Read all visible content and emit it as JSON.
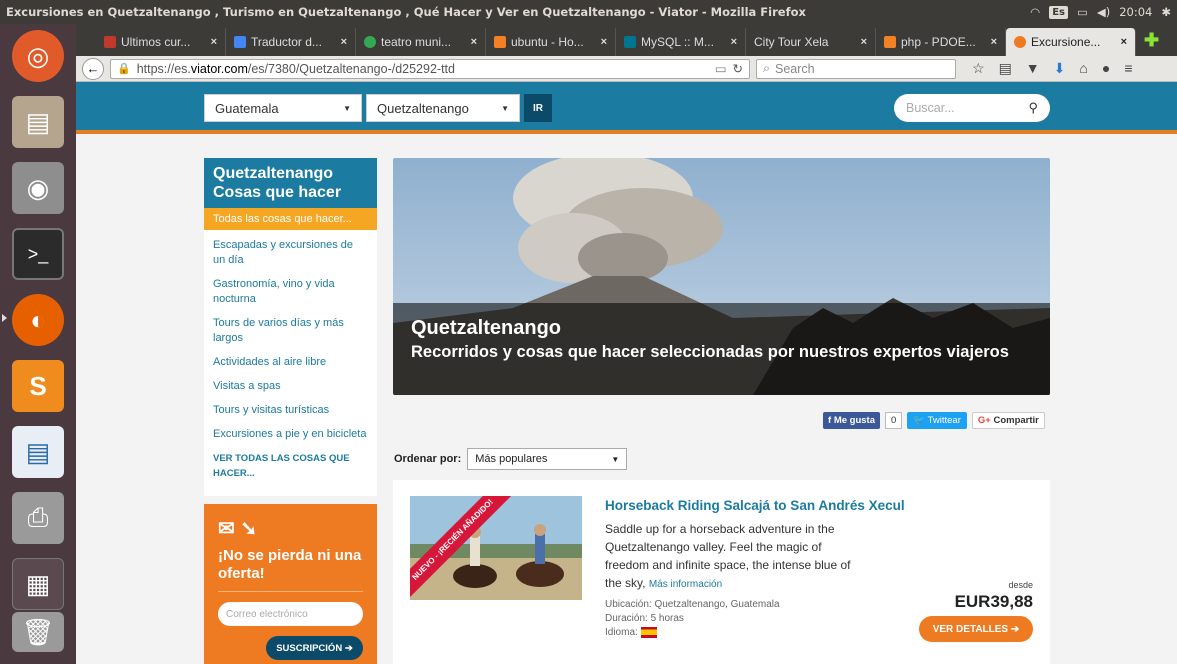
{
  "window_title": "Excursiones en Quetzaltenango , Turismo en Quetzaltenango , Qué Hacer y Ver en Quetzaltenango - Viator - Mozilla Firefox",
  "tray": {
    "lang": "Es",
    "time": "20:04"
  },
  "tabs": [
    {
      "label": "Ultimos cur...",
      "color": "#c0392b"
    },
    {
      "label": "Traductor d...",
      "color": "#4285f4"
    },
    {
      "label": "teatro muni...",
      "color": "#34a853"
    },
    {
      "label": "ubuntu - Ho...",
      "color": "#f48024"
    },
    {
      "label": "MySQL :: M...",
      "color": "#00758f"
    },
    {
      "label": "City Tour Xela",
      "color": ""
    },
    {
      "label": "php - PDOE...",
      "color": "#f48024"
    },
    {
      "label": "Excursione...",
      "color": "#ee7a22"
    }
  ],
  "url": {
    "prefix": "https://es.",
    "domain": "viator.com",
    "path": "/es/7380/Quetzaltenango-/d25292-ttd"
  },
  "browser_search_placeholder": "Search",
  "header": {
    "country": "Guatemala",
    "city": "Quetzaltenango",
    "go": "IR",
    "search_placeholder": "Buscar..."
  },
  "sidebar": {
    "title": "Quetzaltenango Cosas que hacer",
    "active": "Todas las cosas que hacer...",
    "items": [
      "Escapadas y excursiones de un día",
      "Gastronomía, vino y vida nocturna",
      "Tours de varios días y más largos",
      "Actividades al aire libre",
      "Visitas a spas",
      "Tours y visitas turísticas",
      "Excursiones a pie y en bicicleta"
    ],
    "all_link": "VER TODAS LAS COSAS QUE HACER..."
  },
  "promo": {
    "title": "¡No se pierda ni una oferta!",
    "email_placeholder": "Correo electrónico",
    "button": "SUSCRIPCIÓN ➔"
  },
  "hero": {
    "title": "Quetzaltenango",
    "subtitle": "Recorridos y cosas que hacer seleccionadas por nuestros expertos viajeros"
  },
  "social": {
    "like": "Me gusta",
    "like_count": "0",
    "tweet": "Twittear",
    "share": "Compartir"
  },
  "sort": {
    "label": "Ordenar por:",
    "value": "Más populares"
  },
  "product": {
    "ribbon": "NUEVO - ¡RECIÉN AÑADIDO!",
    "title": "Horseback Riding Salcajá to San Andrés Xecul",
    "description": "Saddle up for a horseback adventure in the Quetzaltenango valley. Feel the magic of freedom and infinite space, the intense blue of the sky,",
    "more": "Más información",
    "location": "Ubicación: Quetzaltenango, Guatemala",
    "duration": "Duración: 5 horas",
    "language": "Idioma:",
    "from": "desde",
    "price": "EUR39,88",
    "cta": "VER DETALLES ➔"
  }
}
